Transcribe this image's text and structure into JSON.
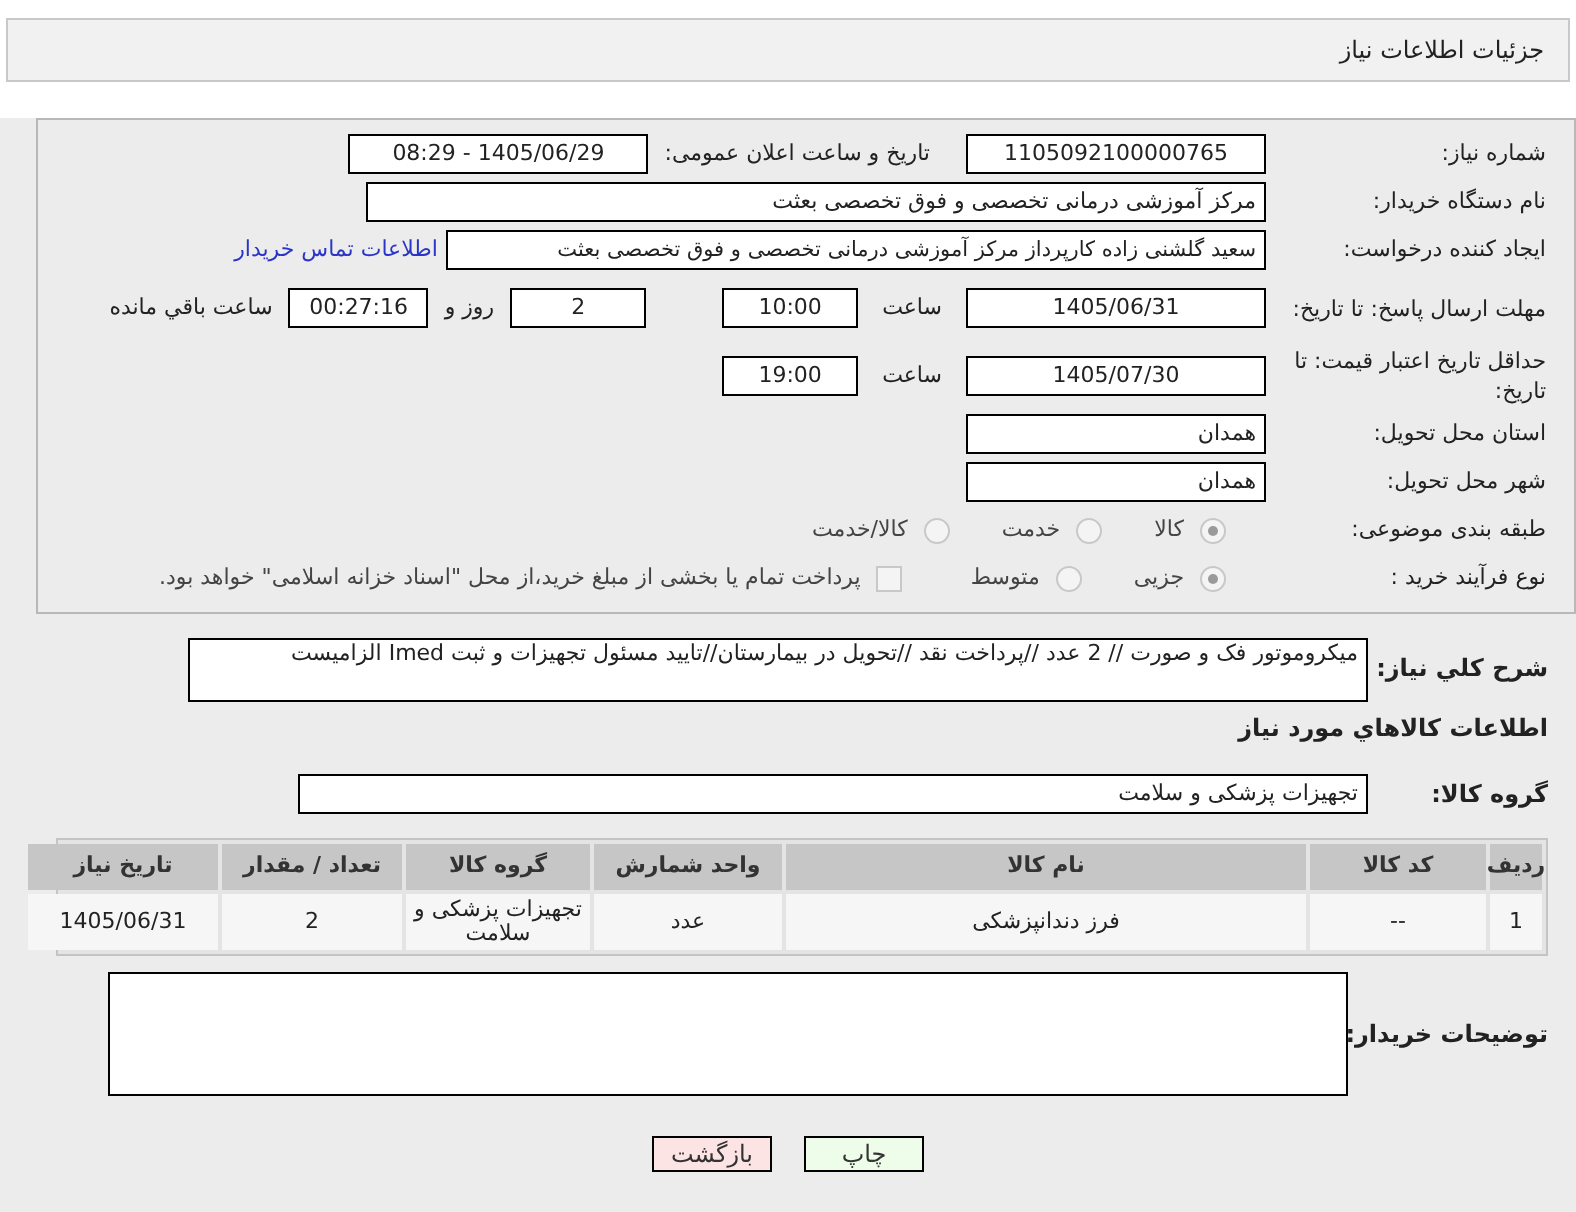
{
  "header": {
    "title": "جزئیات اطلاعات نیاز"
  },
  "need_number": {
    "label": "شماره نیاز:",
    "value": "1105092100000765"
  },
  "announce": {
    "label": "تاریخ و ساعت اعلان عمومی:",
    "value": "1405/06/29 - 08:29"
  },
  "buyer_org": {
    "label": "نام دستگاه خریدار:",
    "value": "مرکز آموزشی درمانی تخصصی و فوق تخصصی بعثت"
  },
  "creator": {
    "label": "ایجاد کننده درخواست:",
    "value": "سعید گلشنی زاده کارپرداز مرکز آموزشی درمانی تخصصی و فوق تخصصی بعثت",
    "link": "اطلاعات تماس خریدار"
  },
  "deadline": {
    "label": "مهلت ارسال پاسخ: تا تاریخ:",
    "date": "1405/06/31",
    "time_label": "ساعت",
    "time": "10:00",
    "days": "2",
    "days_label": "روز و",
    "remaining": "00:27:16",
    "remaining_label": "ساعت باقي مانده"
  },
  "validity": {
    "label": "حداقل تاریخ اعتبار قیمت: تا تاریخ:",
    "date": "1405/07/30",
    "time_label": "ساعت",
    "time": "19:00"
  },
  "province": {
    "label": "استان محل تحویل:",
    "value": "همدان"
  },
  "city": {
    "label": "شهر محل تحویل:",
    "value": "همدان"
  },
  "category": {
    "label": "طبقه بندی موضوعی:",
    "options": [
      {
        "label": "کالا",
        "selected": true
      },
      {
        "label": "خدمت",
        "selected": false
      },
      {
        "label": "کالا/خدمت",
        "selected": false
      }
    ]
  },
  "process": {
    "label": "نوع فرآیند خرید :",
    "options": [
      {
        "label": "جزیی",
        "selected": true
      },
      {
        "label": "متوسط",
        "selected": false
      }
    ],
    "payment": {
      "checked": false,
      "label": "پرداخت تمام یا بخشی از مبلغ خرید،از محل \"اسناد خزانه اسلامی\" خواهد بود."
    }
  },
  "description": {
    "label": "شرح کلي نیاز:",
    "value": "میکروموتور فک و صورت // 2 عدد //پرداخت  نقد //تحویل در بیمارستان//تایید مسئول تجهیزات و ثبت Imed الزامیست"
  },
  "goods_heading": "اطلاعات کالاهاي مورد نیاز",
  "goods_group": {
    "label": "گروه کالا:",
    "value": "تجهیزات پزشکی و سلامت"
  },
  "table": {
    "columns": [
      "ردیف",
      "کد کالا",
      "نام کالا",
      "واحد شمارش",
      "گروه کالا",
      "تعداد / مقدار",
      "تاریخ نیاز"
    ],
    "rows": [
      [
        "1",
        "--",
        "فرز دندانپزشکی",
        "عدد",
        "تجهیزات پزشکی و سلامت",
        "2",
        "1405/06/31"
      ]
    ]
  },
  "buyer_notes": {
    "label": "توضیحات خریدار:"
  },
  "buttons": [
    {
      "kind": "print",
      "label": "چاپ"
    },
    {
      "kind": "back",
      "label": "بازگشت"
    }
  ]
}
